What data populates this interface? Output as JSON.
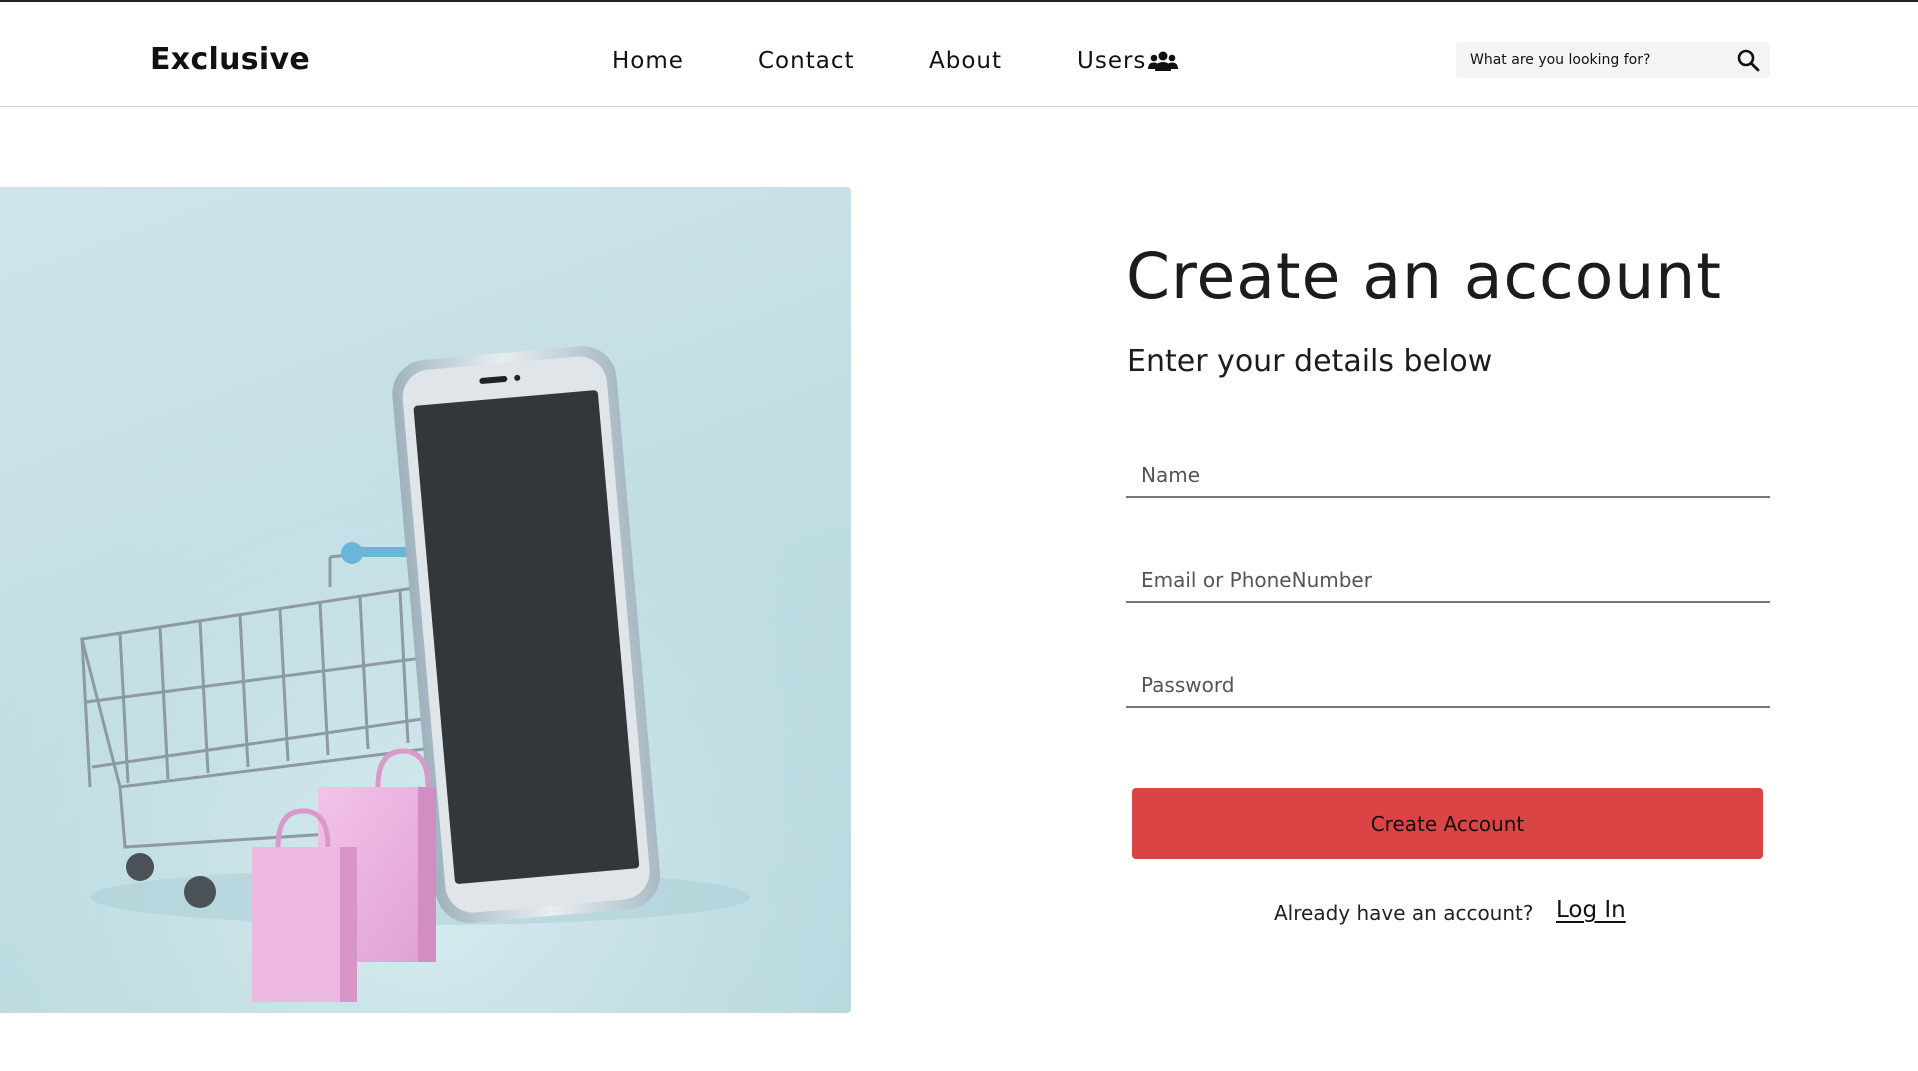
{
  "header": {
    "logo": "Exclusive",
    "nav": [
      {
        "label": "Home"
      },
      {
        "label": "Contact"
      },
      {
        "label": "About"
      },
      {
        "label": "Users",
        "icon": "users-icon"
      }
    ],
    "search": {
      "placeholder": "What are you looking for?",
      "icon": "search-icon"
    }
  },
  "hero": {
    "image": "shopping-cart-phone-bags"
  },
  "form": {
    "title": "Create an account",
    "subtitle": "Enter your details below",
    "fields": [
      {
        "placeholder": "Name",
        "value": ""
      },
      {
        "placeholder": "Email or PhoneNumber",
        "value": ""
      },
      {
        "placeholder": "Password",
        "value": ""
      }
    ],
    "submit_label": "Create Account",
    "already_text": "Already have an account?",
    "login_label": "Log In"
  },
  "colors": {
    "accent": "#db4444",
    "hero_bg": "#c4e0e6"
  }
}
